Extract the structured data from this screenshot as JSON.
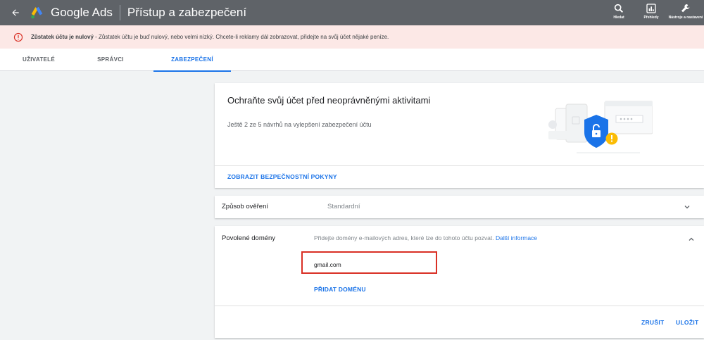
{
  "header": {
    "brand": "Google Ads",
    "title": "Přístup a zabezpečení",
    "tools": [
      {
        "label": "Hledat",
        "icon": "search-icon"
      },
      {
        "label": "Přehledy",
        "icon": "reports-icon"
      },
      {
        "label": "Nástroje a nastavení",
        "icon": "tools-icon"
      }
    ]
  },
  "alert": {
    "bold": "Zůstatek účtu je nulový",
    "text": " - Zůstatek účtu je buď nulový, nebo velmi nízký. Chcete-li reklamy dál zobrazovat, přidejte na svůj účet nějaké peníze."
  },
  "tabs": [
    {
      "label": "UŽIVATELÉ",
      "active": false
    },
    {
      "label": "SPRÁVCI",
      "active": false
    },
    {
      "label": "ZABEZPEČENÍ",
      "active": true
    }
  ],
  "security_card": {
    "title": "Ochraňte svůj účet před neoprávněnými aktivitami",
    "subtitle": "Ještě 2 ze 5 návrhů na vylepšení zabezpečení účtu",
    "link": "ZOBRAZIT BEZPEČNOSTNÍ POKYNY"
  },
  "verification": {
    "label": "Způsob ověření",
    "value": "Standardní"
  },
  "domains": {
    "label": "Povolené domény",
    "hint": "Přidejte domény e-mailových adres, které lze do tohoto účtu pozvat.",
    "hint_link": "Další informace",
    "entries": [
      "gmail.com"
    ],
    "add_label": "PŘIDAT DOMÉNU",
    "cancel_label": "ZRUŠIT",
    "save_label": "ULOŽIT"
  },
  "colors": {
    "topbar": "#5f6368",
    "accent": "#1a73e8",
    "alert_bg": "#fce8e6",
    "alert_icon": "#d93025",
    "highlight_border": "#d93025"
  }
}
